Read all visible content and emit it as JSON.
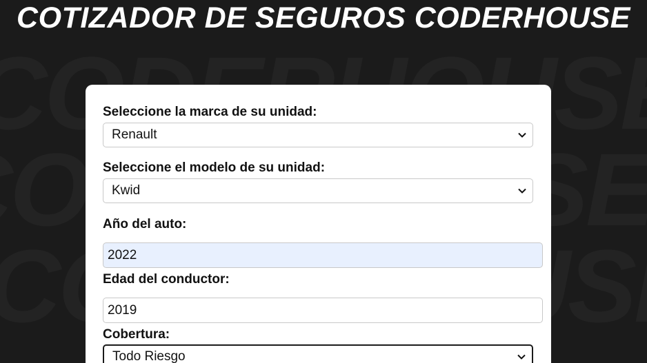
{
  "header": {
    "title": "COTIZADOR DE SEGUROS CODERHOUSE",
    "background_word": "CODERHOUSE"
  },
  "form": {
    "brand": {
      "label": "Seleccione la marca de su unidad:",
      "selected": "Renault"
    },
    "model": {
      "label": "Seleccione el modelo de su unidad:",
      "selected": "Kwid"
    },
    "year": {
      "label": "Año del auto:",
      "value": "2022"
    },
    "driver_age": {
      "label": "Edad del conductor:",
      "value": "2019"
    },
    "coverage": {
      "label": "Cobertura:",
      "selected": "Todo Riesgo"
    }
  },
  "colors": {
    "background": "#1b1b1b",
    "card": "#ffffff",
    "autofill": "#e8f0fe"
  },
  "icons": {
    "dropdown": "chevron-down-icon"
  }
}
